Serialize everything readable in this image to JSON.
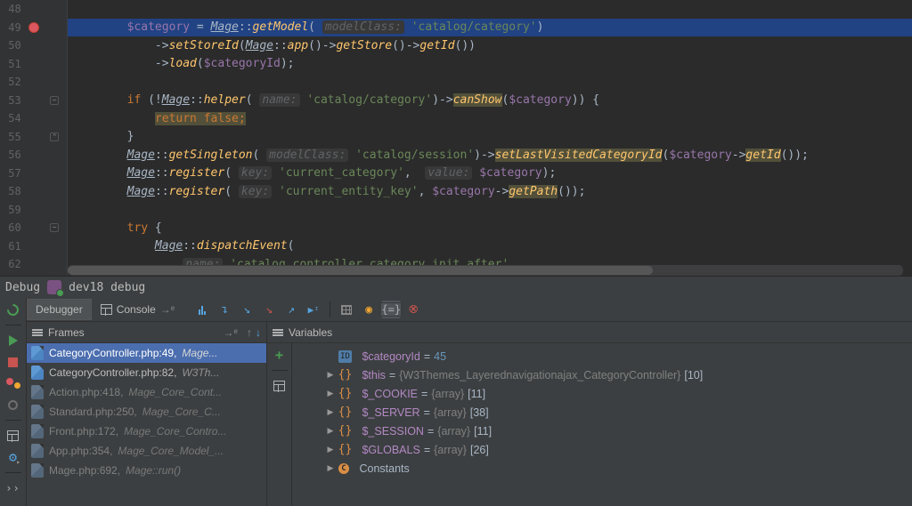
{
  "editor": {
    "breakpoint_line": 49,
    "lines": [
      {
        "n": 48,
        "fold": null,
        "tokens": []
      },
      {
        "n": 49,
        "fold": null,
        "hl": true,
        "bp": true,
        "tokens": [
          {
            "i": 8,
            "p": [
              {
                "c": "t-var",
                "t": "$category"
              },
              {
                "c": "t-op",
                "t": " = "
              },
              {
                "c": "t-cls",
                "t": "Mage"
              },
              {
                "c": "t-op",
                "t": "::"
              },
              {
                "c": "t-yel t-mth",
                "t": "getModel"
              },
              {
                "c": "t-op",
                "t": "( "
              },
              {
                "c": "t-hint",
                "t": "modelClass:"
              },
              {
                "c": "",
                "t": " "
              },
              {
                "c": "t-str",
                "t": "'catalog/category'"
              },
              {
                "c": "t-op",
                "t": ")"
              }
            ]
          }
        ]
      },
      {
        "n": 50,
        "fold": null,
        "tokens": [
          {
            "i": 12,
            "p": [
              {
                "c": "t-op",
                "t": "->"
              },
              {
                "c": "t-yel",
                "t": "setStoreId"
              },
              {
                "c": "t-op",
                "t": "("
              },
              {
                "c": "t-cls",
                "t": "Mage"
              },
              {
                "c": "t-op",
                "t": "::"
              },
              {
                "c": "t-yel t-mth",
                "t": "app"
              },
              {
                "c": "t-op",
                "t": "()->"
              },
              {
                "c": "t-yel",
                "t": "getStore"
              },
              {
                "c": "t-op",
                "t": "()->"
              },
              {
                "c": "t-yel",
                "t": "getId"
              },
              {
                "c": "t-op",
                "t": "())"
              }
            ]
          }
        ]
      },
      {
        "n": 51,
        "fold": null,
        "tokens": [
          {
            "i": 12,
            "p": [
              {
                "c": "t-op",
                "t": "->"
              },
              {
                "c": "t-yel",
                "t": "load"
              },
              {
                "c": "t-op",
                "t": "("
              },
              {
                "c": "t-var",
                "t": "$categoryId"
              },
              {
                "c": "t-op",
                "t": ");"
              }
            ]
          }
        ]
      },
      {
        "n": 52,
        "fold": null,
        "tokens": []
      },
      {
        "n": 53,
        "fold": "-",
        "tokens": [
          {
            "i": 8,
            "p": [
              {
                "c": "t-kw",
                "t": "if"
              },
              {
                "c": "t-op",
                "t": " (!"
              },
              {
                "c": "t-cls",
                "t": "Mage"
              },
              {
                "c": "t-op",
                "t": "::"
              },
              {
                "c": "t-yel t-mth",
                "t": "helper"
              },
              {
                "c": "t-op",
                "t": "( "
              },
              {
                "c": "t-hint",
                "t": "name:"
              },
              {
                "c": "",
                "t": " "
              },
              {
                "c": "t-str",
                "t": "'catalog/category'"
              },
              {
                "c": "t-op",
                "t": ")->"
              },
              {
                "c": "t-yel-hl",
                "t": "canShow"
              },
              {
                "c": "t-op",
                "t": "("
              },
              {
                "c": "t-var",
                "t": "$category"
              },
              {
                "c": "t-op",
                "t": ")) {"
              }
            ]
          }
        ]
      },
      {
        "n": 54,
        "fold": null,
        "tokens": [
          {
            "i": 12,
            "p": [
              {
                "c": "t-kw-hl",
                "t": "return false;"
              }
            ]
          }
        ]
      },
      {
        "n": 55,
        "fold": "^",
        "tokens": [
          {
            "i": 8,
            "p": [
              {
                "c": "t-op",
                "t": "}"
              }
            ]
          }
        ]
      },
      {
        "n": 56,
        "fold": null,
        "tokens": [
          {
            "i": 8,
            "p": [
              {
                "c": "t-cls",
                "t": "Mage"
              },
              {
                "c": "t-op",
                "t": "::"
              },
              {
                "c": "t-yel t-mth",
                "t": "getSingleton"
              },
              {
                "c": "t-op",
                "t": "( "
              },
              {
                "c": "t-hint",
                "t": "modelClass:"
              },
              {
                "c": "",
                "t": " "
              },
              {
                "c": "t-str",
                "t": "'catalog/session'"
              },
              {
                "c": "t-op",
                "t": ")->"
              },
              {
                "c": "t-yel-hl",
                "t": "setLastVisitedCategoryId"
              },
              {
                "c": "t-op",
                "t": "("
              },
              {
                "c": "t-var",
                "t": "$category"
              },
              {
                "c": "t-op",
                "t": "->"
              },
              {
                "c": "t-yel-hl",
                "t": "getId"
              },
              {
                "c": "t-op",
                "t": "());"
              }
            ]
          }
        ]
      },
      {
        "n": 57,
        "fold": null,
        "tokens": [
          {
            "i": 8,
            "p": [
              {
                "c": "t-cls",
                "t": "Mage"
              },
              {
                "c": "t-op",
                "t": "::"
              },
              {
                "c": "t-yel t-mth",
                "t": "register"
              },
              {
                "c": "t-op",
                "t": "( "
              },
              {
                "c": "t-hint",
                "t": "key:"
              },
              {
                "c": "",
                "t": " "
              },
              {
                "c": "t-str",
                "t": "'current_category'"
              },
              {
                "c": "t-op",
                "t": ",  "
              },
              {
                "c": "t-hint",
                "t": "value:"
              },
              {
                "c": "",
                "t": " "
              },
              {
                "c": "t-var",
                "t": "$category"
              },
              {
                "c": "t-op",
                "t": ");"
              }
            ]
          }
        ]
      },
      {
        "n": 58,
        "fold": null,
        "tokens": [
          {
            "i": 8,
            "p": [
              {
                "c": "t-cls",
                "t": "Mage"
              },
              {
                "c": "t-op",
                "t": "::"
              },
              {
                "c": "t-yel t-mth",
                "t": "register"
              },
              {
                "c": "t-op",
                "t": "( "
              },
              {
                "c": "t-hint",
                "t": "key:"
              },
              {
                "c": "",
                "t": " "
              },
              {
                "c": "t-str",
                "t": "'current_entity_key'"
              },
              {
                "c": "t-op",
                "t": ", "
              },
              {
                "c": "t-var",
                "t": "$category"
              },
              {
                "c": "t-op",
                "t": "->"
              },
              {
                "c": "t-yel-hl",
                "t": "getPath"
              },
              {
                "c": "t-op",
                "t": "());"
              }
            ]
          }
        ]
      },
      {
        "n": 59,
        "fold": null,
        "tokens": []
      },
      {
        "n": 60,
        "fold": "-",
        "tokens": [
          {
            "i": 8,
            "p": [
              {
                "c": "t-kw",
                "t": "try"
              },
              {
                "c": "t-op",
                "t": " {"
              }
            ]
          }
        ]
      },
      {
        "n": 61,
        "fold": null,
        "tokens": [
          {
            "i": 12,
            "p": [
              {
                "c": "t-cls",
                "t": "Mage"
              },
              {
                "c": "t-op",
                "t": "::"
              },
              {
                "c": "t-yel t-mth",
                "t": "dispatchEvent"
              },
              {
                "c": "t-op",
                "t": "("
              }
            ]
          }
        ]
      },
      {
        "n": 62,
        "fold": null,
        "tokens": [
          {
            "i": 16,
            "p": [
              {
                "c": "t-hint",
                "t": "name:"
              },
              {
                "c": "",
                "t": " "
              },
              {
                "c": "t-str",
                "t": "'catalog_controller_category_init_after'"
              },
              {
                "c": "t-op",
                "t": ","
              }
            ]
          }
        ]
      }
    ]
  },
  "debug": {
    "title_prefix": "Debug",
    "config": "dev18 debug",
    "tabs": {
      "debugger": "Debugger",
      "console": "Console",
      "console_out": "→ᵉ"
    },
    "frames_title": "Frames",
    "vars_title": "Variables",
    "frames": [
      {
        "sel": true,
        "dim": false,
        "loc": "CategoryController.php:49",
        "cls": "Mage..."
      },
      {
        "sel": false,
        "dim": false,
        "loc": "CategoryController.php:82",
        "cls": "W3Th..."
      },
      {
        "sel": false,
        "dim": true,
        "loc": "Action.php:418",
        "cls": "Mage_Core_Cont..."
      },
      {
        "sel": false,
        "dim": true,
        "loc": "Standard.php:250",
        "cls": "Mage_Core_C..."
      },
      {
        "sel": false,
        "dim": true,
        "loc": "Front.php:172",
        "cls": "Mage_Core_Contro..."
      },
      {
        "sel": false,
        "dim": true,
        "loc": "App.php:354",
        "cls": "Mage_Core_Model_..."
      },
      {
        "sel": false,
        "dim": true,
        "loc": "Mage.php:692",
        "cls": "Mage::run()"
      }
    ],
    "vars": [
      {
        "exp": "",
        "icon": "id",
        "name": "$categoryId",
        "eq": " = ",
        "val": "45",
        "valc": "vn-b"
      },
      {
        "exp": "▶",
        "icon": "br",
        "name": "$this",
        "eq": " = ",
        "val": "{W3Themes_Layerednavigationajax_CategoryController} ",
        "tail": "[10]"
      },
      {
        "exp": "▶",
        "icon": "br",
        "name": "$_COOKIE",
        "eq": " = ",
        "val": "{array} ",
        "tail": "[11]"
      },
      {
        "exp": "▶",
        "icon": "br",
        "name": "$_SERVER",
        "eq": " = ",
        "val": "{array} ",
        "tail": "[38]"
      },
      {
        "exp": "▶",
        "icon": "br",
        "name": "$_SESSION",
        "eq": " = ",
        "val": "{array} ",
        "tail": "[11]"
      },
      {
        "exp": "▶",
        "icon": "br",
        "name": "$GLOBALS",
        "eq": " = ",
        "val": "{array} ",
        "tail": "[26]"
      },
      {
        "exp": "▶",
        "icon": "c",
        "name": "Constants",
        "namec": "ve"
      }
    ]
  }
}
